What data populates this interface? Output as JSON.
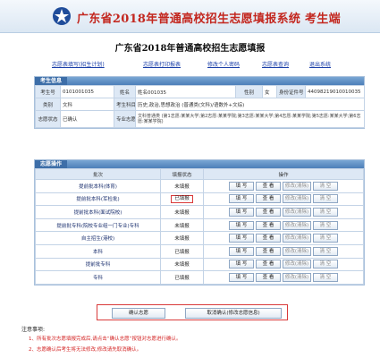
{
  "header": {
    "title": "广东省2018年普通高校招生志愿填报系统  考生端"
  },
  "page_title": "广东省2018年普通高校招生志愿填报",
  "nav": [
    {
      "label": "志愿表填写(招生计划)"
    },
    {
      "label": "志愿表打印报表"
    },
    {
      "label": "修改个人密码"
    },
    {
      "label": "志愿表查询"
    },
    {
      "label": "退出系统"
    }
  ],
  "student_info": {
    "section_title": "考生信息",
    "rows": [
      [
        "考生号",
        "0101001035",
        "姓名",
        "姓名001035",
        "性别",
        "女",
        "身份证件号",
        "44098219010010035"
      ],
      [
        "类别",
        "文科",
        "考生科目",
        "历史,政治,思想政治 (普通类(文科)/语数外+文综)"
      ],
      [
        "志愿状态",
        "已确认",
        "专业志愿",
        "文科普通类 (第1志愿:某某大学;第2志愿:某某学院;第3志愿:某某大学;第4志愿:某某学院;第5志愿:某某大学;第6志愿:某某学院)"
      ]
    ]
  },
  "volunteer": {
    "section_title": "志愿操作",
    "headers": [
      "批次",
      "填报状态",
      "操作"
    ],
    "buttons": {
      "fill": "填 写",
      "view": "查 看",
      "modify": "修改(清除)",
      "clear": "清 空"
    },
    "rows": [
      {
        "batch": "提前批本科(体育)",
        "status": "未填报"
      },
      {
        "batch": "提前批本科(军检批)",
        "status": "已填报"
      },
      {
        "batch": "提前批本科(面试院校)",
        "status": "未填报"
      },
      {
        "batch": "提前批专科(院校专业组一门专业)专科",
        "status": "未填报"
      },
      {
        "batch": "自主招生(港校)",
        "status": "未填报"
      },
      {
        "batch": "本科",
        "status": "已填报"
      },
      {
        "batch": "提前批专科",
        "status": "未填报"
      },
      {
        "batch": "专科",
        "status": "已填报"
      }
    ]
  },
  "actions": {
    "confirm": "确认志愿",
    "cancel": "取消确认(修改志愿信息)"
  },
  "notes": {
    "title": "注意事项:",
    "items": [
      "1、所有批次志愿填报完成后,请点击“确认志愿”按钮对志愿进行确认。",
      "2、志愿确认后考生将无法修改,修改请先取消确认。"
    ]
  }
}
